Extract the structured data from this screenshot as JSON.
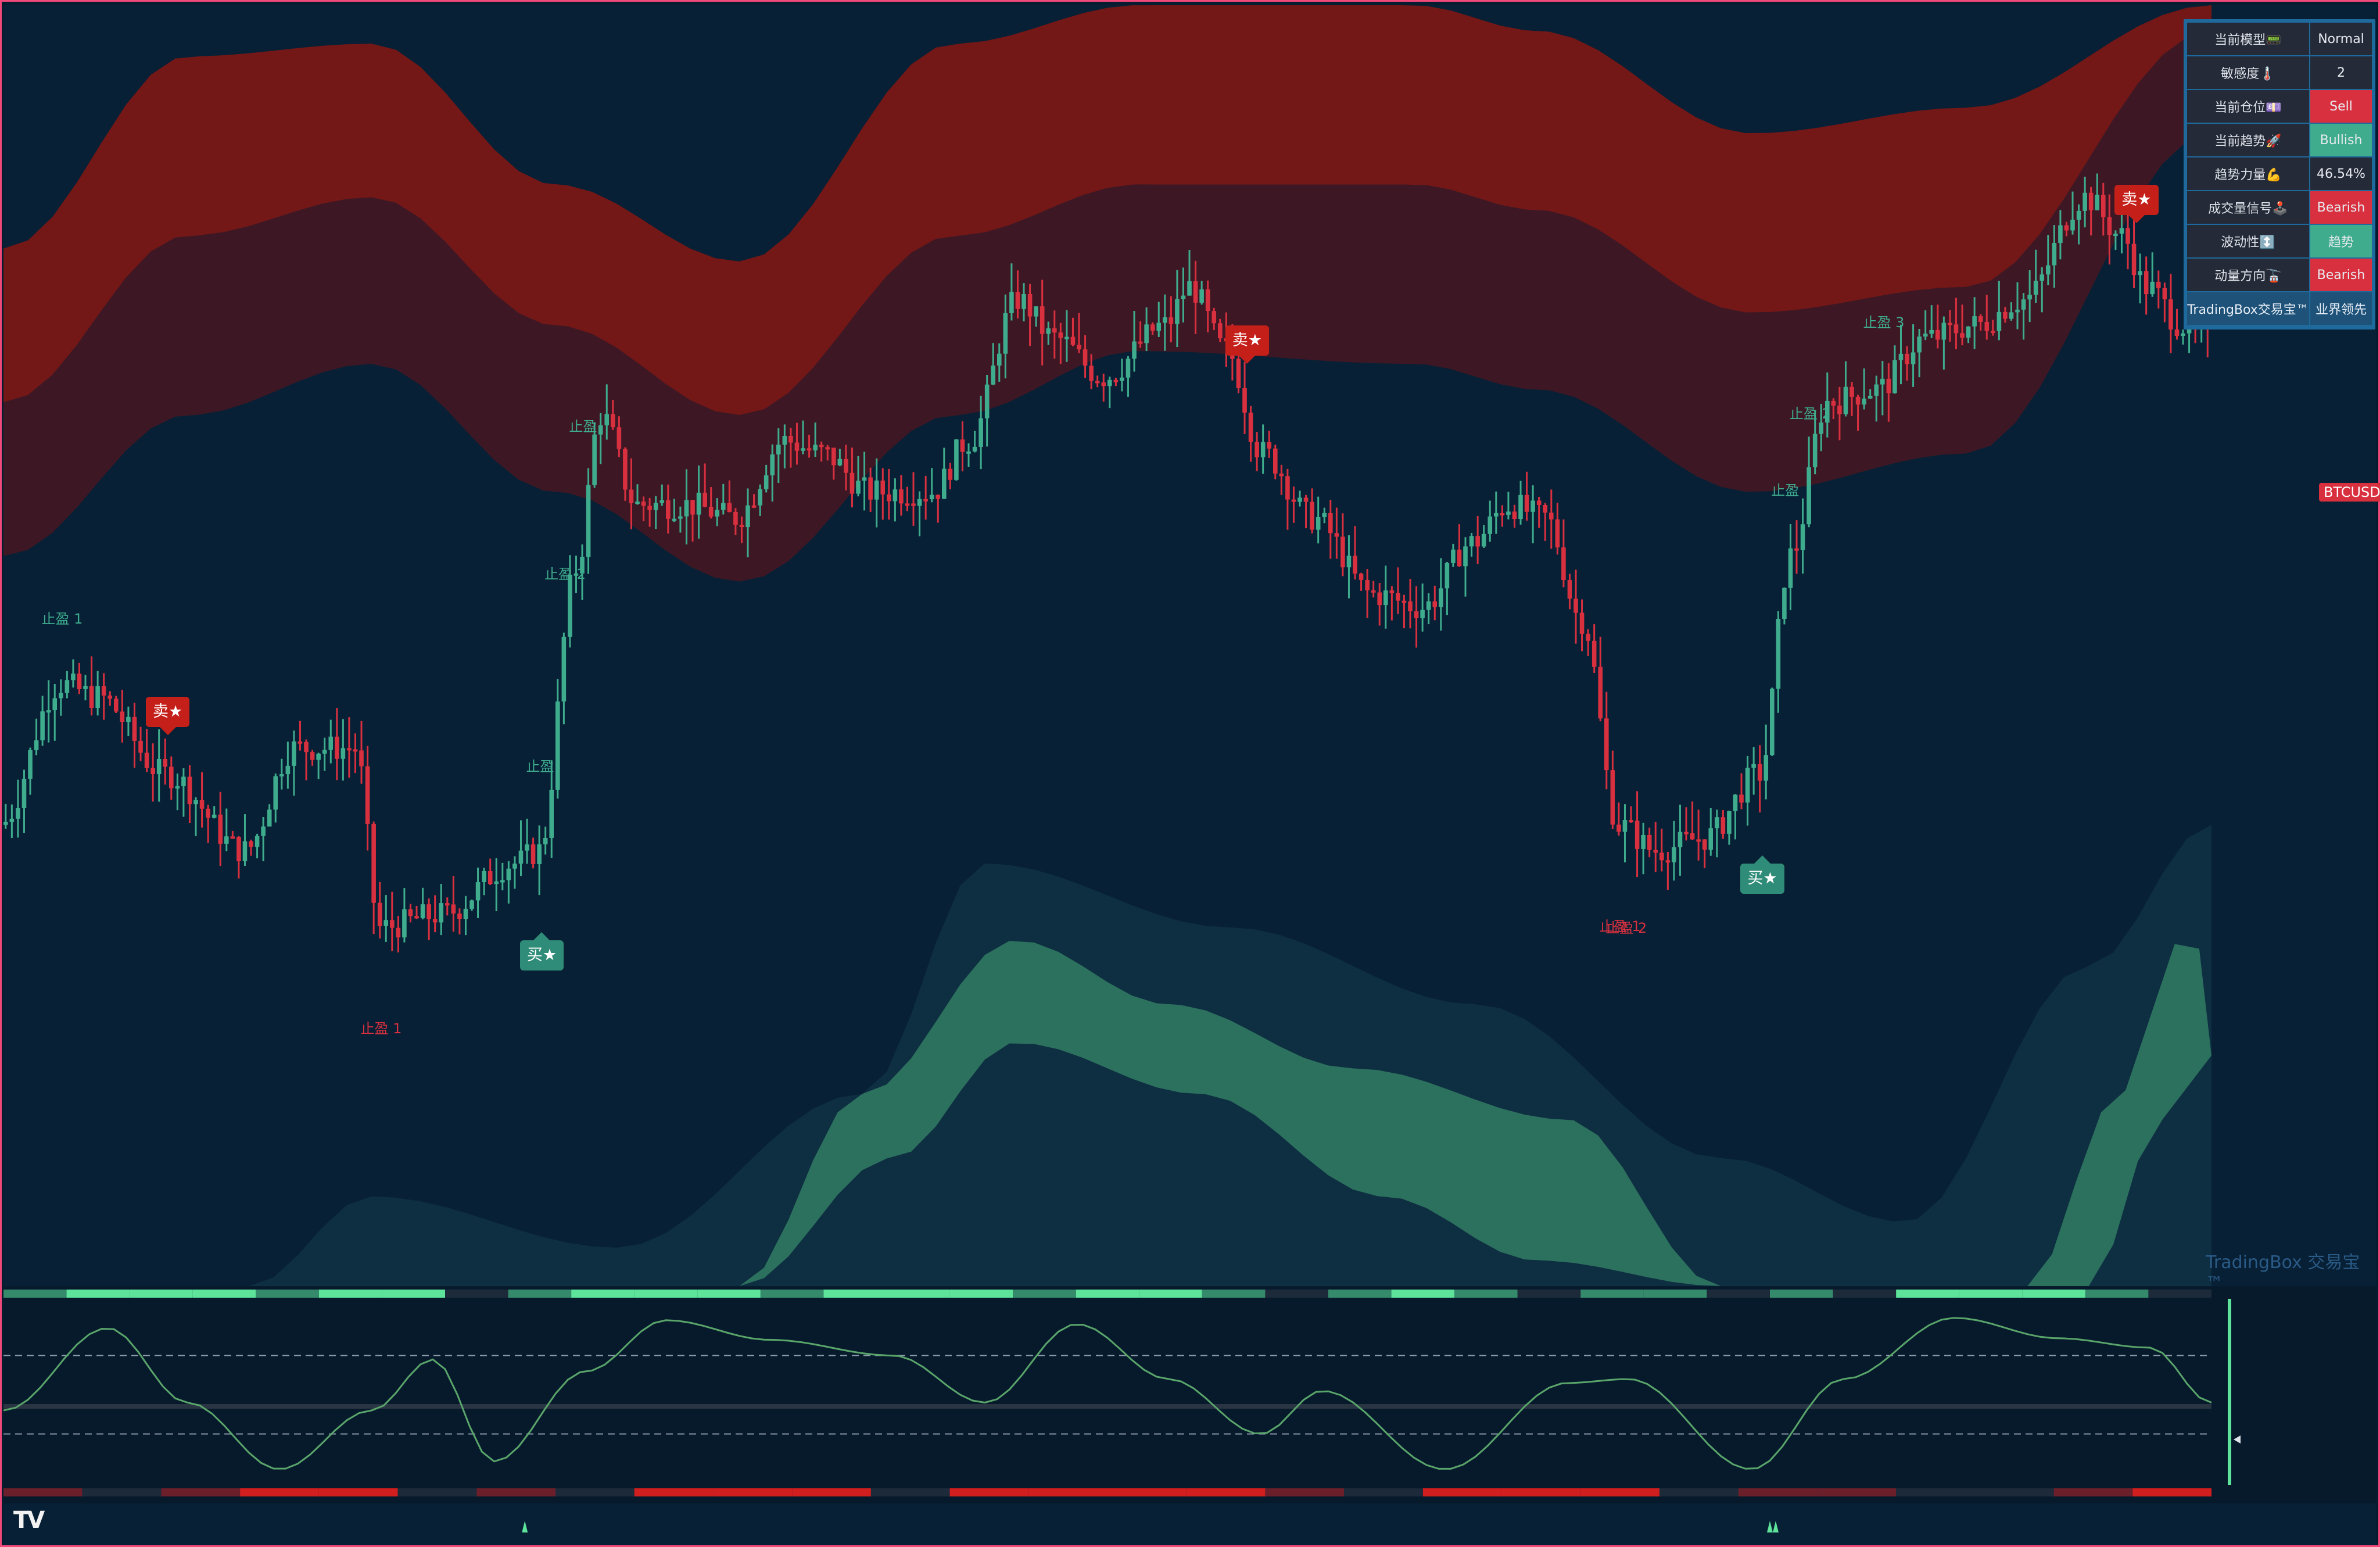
{
  "info_panel": {
    "rows": [
      {
        "label": "当前模型📟",
        "value": "Normal",
        "status": "neutral"
      },
      {
        "label": "敏感度🌡️",
        "value": "2",
        "status": "neutral"
      },
      {
        "label": "当前仓位💷",
        "value": "Sell",
        "status": "red"
      },
      {
        "label": "当前趋势🚀",
        "value": "Bullish",
        "status": "green"
      },
      {
        "label": "趋势力量💪",
        "value": "46.54%",
        "status": "neutral"
      },
      {
        "label": "成交量信号🕹️",
        "value": "Bearish",
        "status": "red"
      },
      {
        "label": "波动性↕️",
        "value": "趋势",
        "status": "green"
      },
      {
        "label": "动量方向🚡",
        "value": "Bearish",
        "status": "red"
      }
    ],
    "brand_label": "TradingBox交易宝™",
    "brand_value": "业界领先"
  },
  "symbol_label": "BTCUSD",
  "watermark_main": "TradingBox 交易宝™",
  "watermark_osc": "TradingBox 交易宝™",
  "logo": "TV",
  "colors": {
    "bull": "#3fac8e",
    "bear": "#d9303f",
    "sell_signal": "#c42019",
    "buy_signal": "#2f8c78",
    "upper_band_outer": "#731717",
    "upper_band_inner": "#3d1824",
    "lower_band_outer": "#0e2e41",
    "lower_band_inner": "#2c705e",
    "osc_bull": "#5de39a",
    "osc_bull_dim": "#358a6c",
    "osc_bear": "#d11e1e",
    "osc_bear_dim": "#6a1f2a"
  },
  "signals": [
    {
      "type": "sell",
      "label": "卖★",
      "bar": 27
    },
    {
      "type": "buy",
      "label": "买★",
      "bar": 88
    },
    {
      "type": "sell",
      "label": "卖★",
      "bar": 203
    },
    {
      "type": "buy",
      "label": "买★",
      "bar": 287
    },
    {
      "type": "sell",
      "label": "卖★",
      "bar": 348
    }
  ],
  "take_profit_labels": [
    {
      "text": "止盈 1",
      "color": "g",
      "bar": 10
    },
    {
      "text": "止盈 1",
      "color": "r",
      "bar": 62
    },
    {
      "text": "止盈",
      "color": "g",
      "bar": 89
    },
    {
      "text": "止盈 2",
      "color": "g",
      "bar": 92
    },
    {
      "text": "止盈",
      "color": "g",
      "bar": 96
    },
    {
      "text": "止盈 1",
      "color": "r",
      "bar": 264
    },
    {
      "text": "止盈 2",
      "color": "r",
      "bar": 265
    },
    {
      "text": "止盈",
      "color": "g",
      "bar": 292
    },
    {
      "text": "止盈 2",
      "color": "g",
      "bar": 295
    },
    {
      "text": "止盈 3",
      "color": "g",
      "bar": 307
    }
  ],
  "chart_data": {
    "type": "candlestick",
    "title": "BTCUSD",
    "xlabel": "",
    "ylabel": "",
    "grid": false,
    "ylim": [
      0,
      100
    ],
    "bar_count": 360,
    "close_path": [
      [
        0,
        36
      ],
      [
        10,
        47
      ],
      [
        16,
        46
      ],
      [
        27,
        40
      ],
      [
        40,
        34
      ],
      [
        48,
        42
      ],
      [
        58,
        42
      ],
      [
        62,
        28
      ],
      [
        72,
        29
      ],
      [
        84,
        33
      ],
      [
        88,
        34
      ],
      [
        94,
        56
      ],
      [
        98,
        68
      ],
      [
        104,
        61
      ],
      [
        112,
        61
      ],
      [
        120,
        60
      ],
      [
        128,
        66
      ],
      [
        134,
        65
      ],
      [
        142,
        62
      ],
      [
        152,
        62
      ],
      [
        158,
        66
      ],
      [
        166,
        77
      ],
      [
        172,
        74
      ],
      [
        180,
        71
      ],
      [
        190,
        75
      ],
      [
        194,
        78
      ],
      [
        200,
        73
      ],
      [
        206,
        65
      ],
      [
        214,
        60
      ],
      [
        224,
        54
      ],
      [
        232,
        53
      ],
      [
        240,
        58
      ],
      [
        246,
        61
      ],
      [
        252,
        60
      ],
      [
        258,
        52
      ],
      [
        264,
        36
      ],
      [
        270,
        34
      ],
      [
        278,
        35
      ],
      [
        287,
        40
      ],
      [
        292,
        57
      ],
      [
        298,
        69
      ],
      [
        306,
        70
      ],
      [
        314,
        74
      ],
      [
        322,
        75
      ],
      [
        330,
        77
      ],
      [
        340,
        85
      ],
      [
        346,
        82
      ],
      [
        350,
        78
      ],
      [
        356,
        75
      ],
      [
        360,
        74
      ]
    ],
    "upper_band_outer_top": [
      [
        0,
        81
      ],
      [
        30,
        96
      ],
      [
        60,
        97
      ],
      [
        90,
        86
      ],
      [
        120,
        80
      ],
      [
        155,
        97
      ],
      [
        185,
        100
      ],
      [
        230,
        100
      ],
      [
        250,
        98
      ],
      [
        285,
        90
      ],
      [
        320,
        92
      ],
      [
        360,
        100
      ]
    ],
    "upper_band_mid": [
      [
        0,
        69
      ],
      [
        30,
        82
      ],
      [
        60,
        85
      ],
      [
        90,
        75
      ],
      [
        120,
        68
      ],
      [
        155,
        82
      ],
      [
        185,
        86
      ],
      [
        230,
        86
      ],
      [
        250,
        84
      ],
      [
        285,
        76
      ],
      [
        320,
        78
      ],
      [
        360,
        98
      ]
    ],
    "upper_band_outer_bottom": [
      [
        0,
        57
      ],
      [
        30,
        68
      ],
      [
        60,
        72
      ],
      [
        90,
        62
      ],
      [
        120,
        55
      ],
      [
        155,
        68
      ],
      [
        185,
        73
      ],
      [
        230,
        72
      ],
      [
        250,
        70
      ],
      [
        285,
        62
      ],
      [
        320,
        65
      ],
      [
        360,
        90
      ]
    ],
    "lower_band_outer_top": [
      [
        40,
        0
      ],
      [
        60,
        7
      ],
      [
        100,
        3
      ],
      [
        140,
        15
      ],
      [
        160,
        33
      ],
      [
        200,
        28
      ],
      [
        240,
        22
      ],
      [
        280,
        10
      ],
      [
        310,
        5
      ],
      [
        340,
        25
      ],
      [
        360,
        36
      ]
    ],
    "lower_band_inner_top": [
      [
        120,
        0
      ],
      [
        140,
        15
      ],
      [
        165,
        27
      ],
      [
        190,
        22
      ],
      [
        220,
        17
      ],
      [
        255,
        13
      ],
      [
        280,
        0
      ]
    ],
    "lower_band_inner_bottom": [
      [
        125,
        0
      ],
      [
        145,
        10
      ],
      [
        165,
        19
      ],
      [
        195,
        15
      ],
      [
        225,
        7
      ],
      [
        250,
        2
      ]
    ],
    "lower_band_right_top": [
      [
        330,
        0
      ],
      [
        345,
        15
      ],
      [
        355,
        27
      ],
      [
        360,
        26
      ]
    ],
    "lower_band_right_bottom": [
      [
        340,
        0
      ],
      [
        352,
        13
      ],
      [
        360,
        18
      ]
    ]
  },
  "oscillator": {
    "top_strip": [
      "dim",
      "bull",
      "bull",
      "bull",
      "dim",
      "bull",
      "bull",
      "none",
      "dim",
      "bull",
      "bull",
      "bull",
      "dim",
      "bull",
      "bull",
      "bull",
      "dim",
      "bull",
      "bull",
      "dim",
      "none",
      "dim",
      "bull",
      "dim",
      "none",
      "dim",
      "dim",
      "none",
      "dim",
      "none",
      "bull",
      "bull",
      "bull",
      "dim",
      "none"
    ],
    "bottom_strip": [
      "bear_dim",
      "none",
      "bear_dim",
      "bear",
      "bear",
      "none",
      "bear_dim",
      "none",
      "bear",
      "bear",
      "bear",
      "none",
      "bear",
      "bear",
      "bear",
      "bear",
      "bear_dim",
      "none",
      "bear",
      "bear",
      "bear",
      "none",
      "bear_dim",
      "bear_dim",
      "none",
      "none",
      "bear_dim",
      "bear"
    ],
    "levels": [
      "upper-dashed",
      "zero",
      "lower-dashed"
    ],
    "wave": [
      [
        0,
        -0.2
      ],
      [
        17,
        0.85
      ],
      [
        30,
        -0.1
      ],
      [
        45,
        -0.95
      ],
      [
        60,
        -0.2
      ],
      [
        70,
        0.45
      ],
      [
        80,
        -0.85
      ],
      [
        95,
        0.3
      ],
      [
        108,
        0.95
      ],
      [
        125,
        0.7
      ],
      [
        145,
        0.5
      ],
      [
        160,
        -0.1
      ],
      [
        175,
        0.9
      ],
      [
        190,
        0.2
      ],
      [
        205,
        -0.5
      ],
      [
        215,
        0.05
      ],
      [
        235,
        -0.95
      ],
      [
        255,
        0.15
      ],
      [
        265,
        0.2
      ],
      [
        285,
        -0.95
      ],
      [
        300,
        0.2
      ],
      [
        318,
        0.98
      ],
      [
        335,
        0.72
      ],
      [
        350,
        0.6
      ],
      [
        360,
        -0.1
      ]
    ],
    "markers": [
      {
        "bar": 85,
        "shape": "triangle-up"
      },
      {
        "bar": 288,
        "shape": "double-triangle-up"
      }
    ]
  }
}
